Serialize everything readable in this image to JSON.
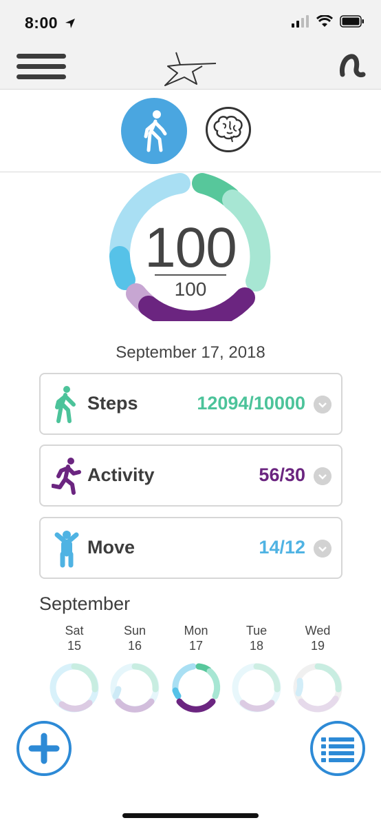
{
  "status_bar": {
    "time": "8:00"
  },
  "header": {
    "menu_icon": "hamburger-icon",
    "logo_icon": "star-logo-icon",
    "right_icon": "hearing-aid-icon"
  },
  "tabs": [
    {
      "name": "activity",
      "icon": "walking-person-icon",
      "selected": true
    },
    {
      "name": "brain",
      "icon": "brain-icon",
      "selected": false
    }
  ],
  "score": {
    "value": "100",
    "goal": "100"
  },
  "date": "September 17, 2018",
  "metrics": [
    {
      "label": "Steps",
      "value": "12094/10000",
      "color": "#4cc39a",
      "icon": "walking-person-icon"
    },
    {
      "label": "Activity",
      "value": "56/30",
      "color": "#6b2580",
      "icon": "running-person-icon"
    },
    {
      "label": "Move",
      "value": "14/12",
      "color": "#4fb3e3",
      "icon": "person-arms-up-icon"
    }
  ],
  "month": "September",
  "days": [
    {
      "name": "Sat",
      "num": "15"
    },
    {
      "name": "Sun",
      "num": "16"
    },
    {
      "name": "Mon",
      "num": "17"
    },
    {
      "name": "Tue",
      "num": "18"
    },
    {
      "name": "Wed",
      "num": "19"
    }
  ],
  "colors": {
    "accent": "#2d8ad6",
    "steps": "#4cc39a",
    "activity": "#6b2580",
    "move": "#4fb3e3"
  }
}
